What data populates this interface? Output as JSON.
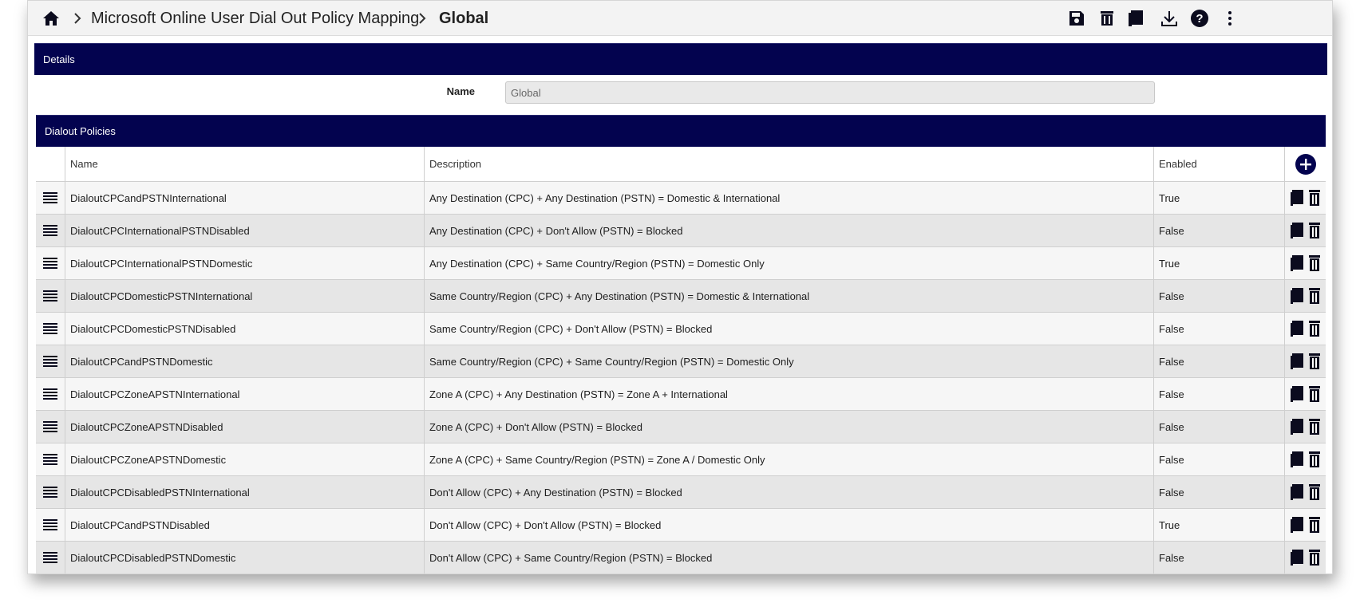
{
  "breadcrumb": {
    "home_icon": "home-icon",
    "items": [
      "Microsoft Online User Dial Out Policy Mapping",
      "Global"
    ]
  },
  "toolbar": {
    "icons": [
      "save-icon",
      "delete-icon",
      "copy-icon",
      "download-icon",
      "help-icon",
      "more-vertical-icon"
    ]
  },
  "details": {
    "header": "Details",
    "name_label": "Name",
    "name_value": "Global"
  },
  "policies": {
    "header": "Dialout Policies",
    "columns": [
      "Name",
      "Description",
      "Enabled"
    ],
    "rows": [
      {
        "name": "DialoutCPCandPSTNInternational",
        "description": "Any Destination (CPC) + Any Destination (PSTN) = Domestic & International",
        "enabled": "True"
      },
      {
        "name": "DialoutCPCInternationalPSTNDisabled",
        "description": "Any Destination (CPC) + Don't Allow (PSTN) = Blocked",
        "enabled": "False"
      },
      {
        "name": "DialoutCPCInternationalPSTNDomestic",
        "description": "Any Destination (CPC) + Same Country/Region (PSTN) = Domestic Only",
        "enabled": "True"
      },
      {
        "name": "DialoutCPCDomesticPSTNInternational",
        "description": "Same Country/Region (CPC) + Any Destination (PSTN) = Domestic & International",
        "enabled": "False"
      },
      {
        "name": "DialoutCPCDomesticPSTNDisabled",
        "description": "Same Country/Region (CPC) + Don't Allow (PSTN) = Blocked",
        "enabled": "False"
      },
      {
        "name": "DialoutCPCandPSTNDomestic",
        "description": "Same Country/Region (CPC) + Same Country/Region (PSTN) = Domestic Only",
        "enabled": "False"
      },
      {
        "name": "DialoutCPCZoneAPSTNInternational",
        "description": "Zone A (CPC) + Any Destination (PSTN) = Zone A + International",
        "enabled": "False"
      },
      {
        "name": "DialoutCPCZoneAPSTNDisabled",
        "description": "Zone A (CPC) + Don't Allow (PSTN) = Blocked",
        "enabled": "False"
      },
      {
        "name": "DialoutCPCZoneAPSTNDomestic",
        "description": "Zone A (CPC) + Same Country/Region (PSTN) = Zone A / Domestic Only",
        "enabled": "False"
      },
      {
        "name": "DialoutCPCDisabledPSTNInternational",
        "description": "Don't Allow (CPC) + Any Destination (PSTN) = Blocked",
        "enabled": "False"
      },
      {
        "name": "DialoutCPCandPSTNDisabled",
        "description": "Don't Allow (CPC) + Don't Allow (PSTN) = Blocked",
        "enabled": "True"
      },
      {
        "name": "DialoutCPCDisabledPSTNDomestic",
        "description": "Don't Allow (CPC) + Same Country/Region (PSTN) = Blocked",
        "enabled": "False"
      }
    ]
  },
  "colors": {
    "header_bg": "#03034f",
    "icon": "#0b0b1e"
  }
}
